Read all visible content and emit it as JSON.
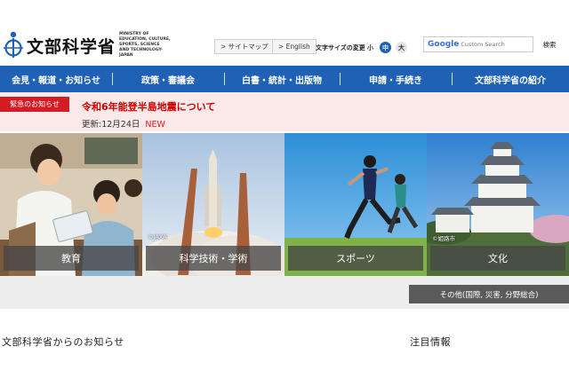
{
  "header": {
    "logo_title": "文部科学省",
    "logo_subtitle": "MINISTRY OF EDUCATION, CULTURE, SPORTS, SCIENCE AND TECHNOLOGY-JAPAN",
    "sitemap": "> サイトマップ",
    "english": "> English",
    "font_size_label": "文字サイズの変更",
    "font_sizes": [
      "小",
      "中",
      "大"
    ],
    "search_google": "Google",
    "search_placeholder": "Custom Search",
    "search_button": "検索"
  },
  "nav": {
    "items": [
      "会見・報道・お知らせ",
      "政策・審議会",
      "白書・統計・出版物",
      "申請・手続き",
      "文部科学省の紹介"
    ]
  },
  "alert": {
    "tag": "緊急のお知らせ",
    "title": "令和6年能登半島地震について",
    "updated": "更新:12月24日",
    "new_badge": "NEW"
  },
  "tiles": [
    {
      "label": "教育",
      "credit": ""
    },
    {
      "label": "科学技術・学術",
      "credit": "©JAXA"
    },
    {
      "label": "スポーツ",
      "credit": ""
    },
    {
      "label": "文化",
      "credit": "©姫路市"
    }
  ],
  "other_button": "その他(国際, 災害, 分野総合)",
  "sections": {
    "news_title": "文部科学省からのお知らせ",
    "featured_title": "注目情報"
  },
  "colors": {
    "nav_bg": "#1f61b5",
    "alert_bg": "#fbe8e8",
    "alert_tag": "#d31c24",
    "fs_active": "#1f61b5"
  }
}
